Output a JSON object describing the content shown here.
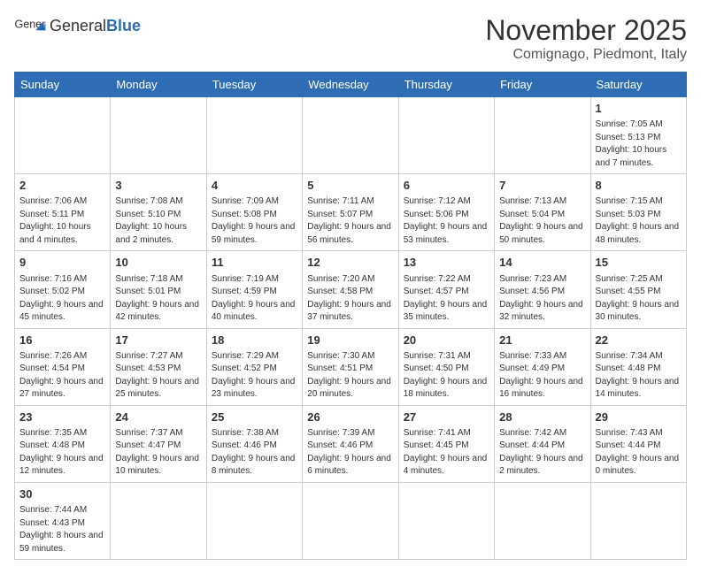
{
  "logo": {
    "text_general": "General",
    "text_blue": "Blue"
  },
  "header": {
    "month": "November 2025",
    "location": "Comignago, Piedmont, Italy"
  },
  "weekdays": [
    "Sunday",
    "Monday",
    "Tuesday",
    "Wednesday",
    "Thursday",
    "Friday",
    "Saturday"
  ],
  "weeks": [
    [
      {
        "day": "",
        "info": ""
      },
      {
        "day": "",
        "info": ""
      },
      {
        "day": "",
        "info": ""
      },
      {
        "day": "",
        "info": ""
      },
      {
        "day": "",
        "info": ""
      },
      {
        "day": "",
        "info": ""
      },
      {
        "day": "1",
        "info": "Sunrise: 7:05 AM\nSunset: 5:13 PM\nDaylight: 10 hours and 7 minutes."
      }
    ],
    [
      {
        "day": "2",
        "info": "Sunrise: 7:06 AM\nSunset: 5:11 PM\nDaylight: 10 hours and 4 minutes."
      },
      {
        "day": "3",
        "info": "Sunrise: 7:08 AM\nSunset: 5:10 PM\nDaylight: 10 hours and 2 minutes."
      },
      {
        "day": "4",
        "info": "Sunrise: 7:09 AM\nSunset: 5:08 PM\nDaylight: 9 hours and 59 minutes."
      },
      {
        "day": "5",
        "info": "Sunrise: 7:11 AM\nSunset: 5:07 PM\nDaylight: 9 hours and 56 minutes."
      },
      {
        "day": "6",
        "info": "Sunrise: 7:12 AM\nSunset: 5:06 PM\nDaylight: 9 hours and 53 minutes."
      },
      {
        "day": "7",
        "info": "Sunrise: 7:13 AM\nSunset: 5:04 PM\nDaylight: 9 hours and 50 minutes."
      },
      {
        "day": "8",
        "info": "Sunrise: 7:15 AM\nSunset: 5:03 PM\nDaylight: 9 hours and 48 minutes."
      }
    ],
    [
      {
        "day": "9",
        "info": "Sunrise: 7:16 AM\nSunset: 5:02 PM\nDaylight: 9 hours and 45 minutes."
      },
      {
        "day": "10",
        "info": "Sunrise: 7:18 AM\nSunset: 5:01 PM\nDaylight: 9 hours and 42 minutes."
      },
      {
        "day": "11",
        "info": "Sunrise: 7:19 AM\nSunset: 4:59 PM\nDaylight: 9 hours and 40 minutes."
      },
      {
        "day": "12",
        "info": "Sunrise: 7:20 AM\nSunset: 4:58 PM\nDaylight: 9 hours and 37 minutes."
      },
      {
        "day": "13",
        "info": "Sunrise: 7:22 AM\nSunset: 4:57 PM\nDaylight: 9 hours and 35 minutes."
      },
      {
        "day": "14",
        "info": "Sunrise: 7:23 AM\nSunset: 4:56 PM\nDaylight: 9 hours and 32 minutes."
      },
      {
        "day": "15",
        "info": "Sunrise: 7:25 AM\nSunset: 4:55 PM\nDaylight: 9 hours and 30 minutes."
      }
    ],
    [
      {
        "day": "16",
        "info": "Sunrise: 7:26 AM\nSunset: 4:54 PM\nDaylight: 9 hours and 27 minutes."
      },
      {
        "day": "17",
        "info": "Sunrise: 7:27 AM\nSunset: 4:53 PM\nDaylight: 9 hours and 25 minutes."
      },
      {
        "day": "18",
        "info": "Sunrise: 7:29 AM\nSunset: 4:52 PM\nDaylight: 9 hours and 23 minutes."
      },
      {
        "day": "19",
        "info": "Sunrise: 7:30 AM\nSunset: 4:51 PM\nDaylight: 9 hours and 20 minutes."
      },
      {
        "day": "20",
        "info": "Sunrise: 7:31 AM\nSunset: 4:50 PM\nDaylight: 9 hours and 18 minutes."
      },
      {
        "day": "21",
        "info": "Sunrise: 7:33 AM\nSunset: 4:49 PM\nDaylight: 9 hours and 16 minutes."
      },
      {
        "day": "22",
        "info": "Sunrise: 7:34 AM\nSunset: 4:48 PM\nDaylight: 9 hours and 14 minutes."
      }
    ],
    [
      {
        "day": "23",
        "info": "Sunrise: 7:35 AM\nSunset: 4:48 PM\nDaylight: 9 hours and 12 minutes."
      },
      {
        "day": "24",
        "info": "Sunrise: 7:37 AM\nSunset: 4:47 PM\nDaylight: 9 hours and 10 minutes."
      },
      {
        "day": "25",
        "info": "Sunrise: 7:38 AM\nSunset: 4:46 PM\nDaylight: 9 hours and 8 minutes."
      },
      {
        "day": "26",
        "info": "Sunrise: 7:39 AM\nSunset: 4:46 PM\nDaylight: 9 hours and 6 minutes."
      },
      {
        "day": "27",
        "info": "Sunrise: 7:41 AM\nSunset: 4:45 PM\nDaylight: 9 hours and 4 minutes."
      },
      {
        "day": "28",
        "info": "Sunrise: 7:42 AM\nSunset: 4:44 PM\nDaylight: 9 hours and 2 minutes."
      },
      {
        "day": "29",
        "info": "Sunrise: 7:43 AM\nSunset: 4:44 PM\nDaylight: 9 hours and 0 minutes."
      }
    ],
    [
      {
        "day": "30",
        "info": "Sunrise: 7:44 AM\nSunset: 4:43 PM\nDaylight: 8 hours and 59 minutes."
      },
      {
        "day": "",
        "info": ""
      },
      {
        "day": "",
        "info": ""
      },
      {
        "day": "",
        "info": ""
      },
      {
        "day": "",
        "info": ""
      },
      {
        "day": "",
        "info": ""
      },
      {
        "day": "",
        "info": ""
      }
    ]
  ]
}
